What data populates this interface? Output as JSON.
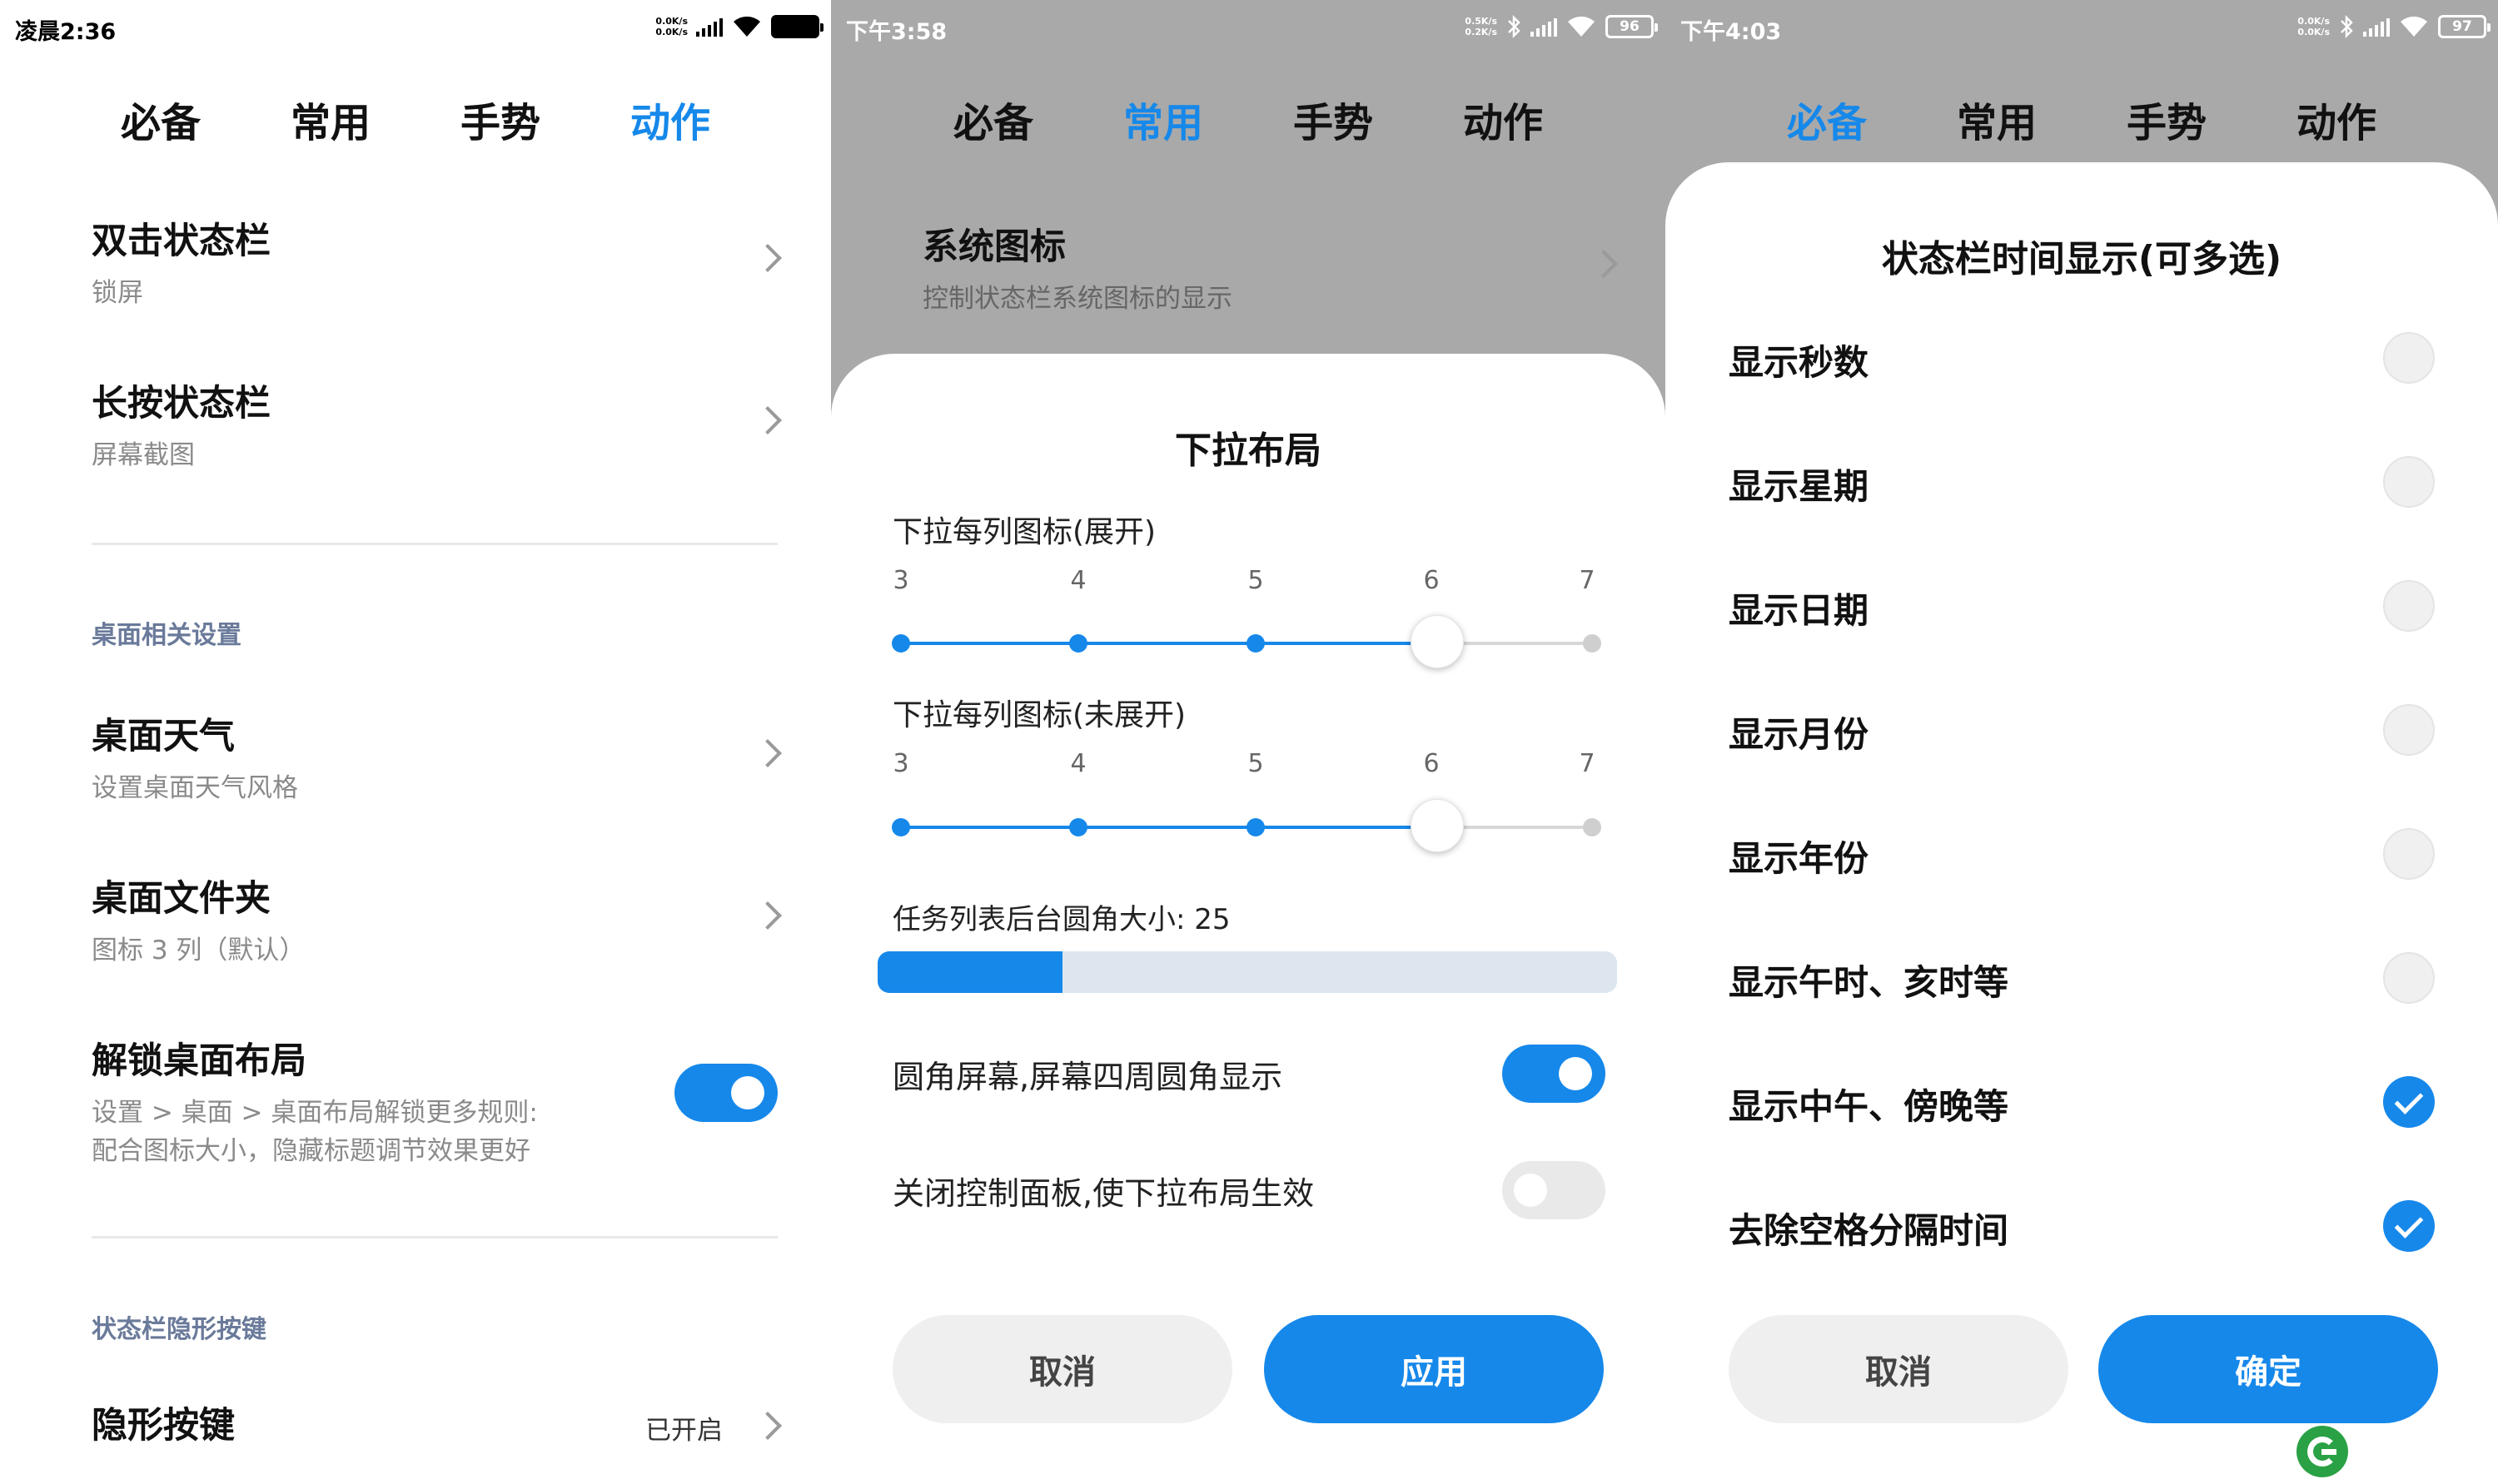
{
  "colors": {
    "accent": "#1688ea",
    "dim_overlay": "#a9a9a9"
  },
  "panel1": {
    "status": {
      "time": "凌晨2:36",
      "speed_up": "0.0K/s",
      "speed_down": "0.0K/s"
    },
    "tabs": [
      {
        "label": "必备",
        "active": false
      },
      {
        "label": "常用",
        "active": false
      },
      {
        "label": "手势",
        "active": false
      },
      {
        "label": "动作",
        "active": true
      }
    ],
    "items": [
      {
        "title": "双击状态栏",
        "subtitle": "锁屏"
      },
      {
        "title": "长按状态栏",
        "subtitle": "屏幕截图"
      },
      {
        "title": "桌面天气",
        "subtitle": "设置桌面天气风格"
      },
      {
        "title": "桌面文件夹",
        "subtitle": "图标 3 列（默认）"
      },
      {
        "title": "解锁桌面布局",
        "subtitle": "设置 > 桌面 > 桌面布局解锁更多规则:\n配合图标大小，隐藏标题调节效果更好",
        "toggle": true
      },
      {
        "title": "隐形按键",
        "value": "已开启"
      }
    ],
    "sections": [
      "桌面相关设置",
      "状态栏隐形按键"
    ]
  },
  "panel2": {
    "status": {
      "time": "下午3:58",
      "speed_up": "0.5K/s",
      "speed_down": "0.2K/s",
      "battery": "96"
    },
    "tabs": [
      {
        "label": "必备",
        "active": false
      },
      {
        "label": "常用",
        "active": true
      },
      {
        "label": "手势",
        "active": false
      },
      {
        "label": "动作",
        "active": false
      }
    ],
    "bg_item": {
      "title": "系统图标",
      "subtitle": "控制状态栏系统图标的显示"
    },
    "sheet": {
      "title": "下拉布局",
      "slider1": {
        "label": "下拉每列图标(展开)",
        "ticks": [
          "3",
          "4",
          "5",
          "6",
          "7"
        ],
        "value": 6
      },
      "slider2": {
        "label": "下拉每列图标(未展开)",
        "ticks": [
          "3",
          "4",
          "5",
          "6",
          "7"
        ],
        "value": 6
      },
      "corner": {
        "label": "任务列表后台圆角大小: 25",
        "fraction": 0.25
      },
      "toggle1": {
        "label": "圆角屏幕,屏幕四周圆角显示",
        "on": true
      },
      "toggle2": {
        "label": "关闭控制面板,使下拉布局生效",
        "on": false
      },
      "cancel": "取消",
      "apply": "应用"
    }
  },
  "panel3": {
    "status": {
      "time": "下午4:03",
      "speed_up": "0.0K/s",
      "speed_down": "0.0K/s",
      "battery": "97"
    },
    "tabs": [
      {
        "label": "必备",
        "active": true
      },
      {
        "label": "常用",
        "active": false
      },
      {
        "label": "手势",
        "active": false
      },
      {
        "label": "动作",
        "active": false
      }
    ],
    "sheet": {
      "title": "状态栏时间显示(可多选)",
      "options": [
        {
          "label": "显示秒数",
          "checked": false
        },
        {
          "label": "显示星期",
          "checked": false
        },
        {
          "label": "显示日期",
          "checked": false
        },
        {
          "label": "显示月份",
          "checked": false
        },
        {
          "label": "显示年份",
          "checked": false
        },
        {
          "label": "显示午时、亥时等",
          "checked": false
        },
        {
          "label": "显示中午、傍晚等",
          "checked": true
        },
        {
          "label": "去除空格分隔时间",
          "checked": true
        }
      ],
      "cancel": "取消",
      "confirm": "确定"
    }
  }
}
